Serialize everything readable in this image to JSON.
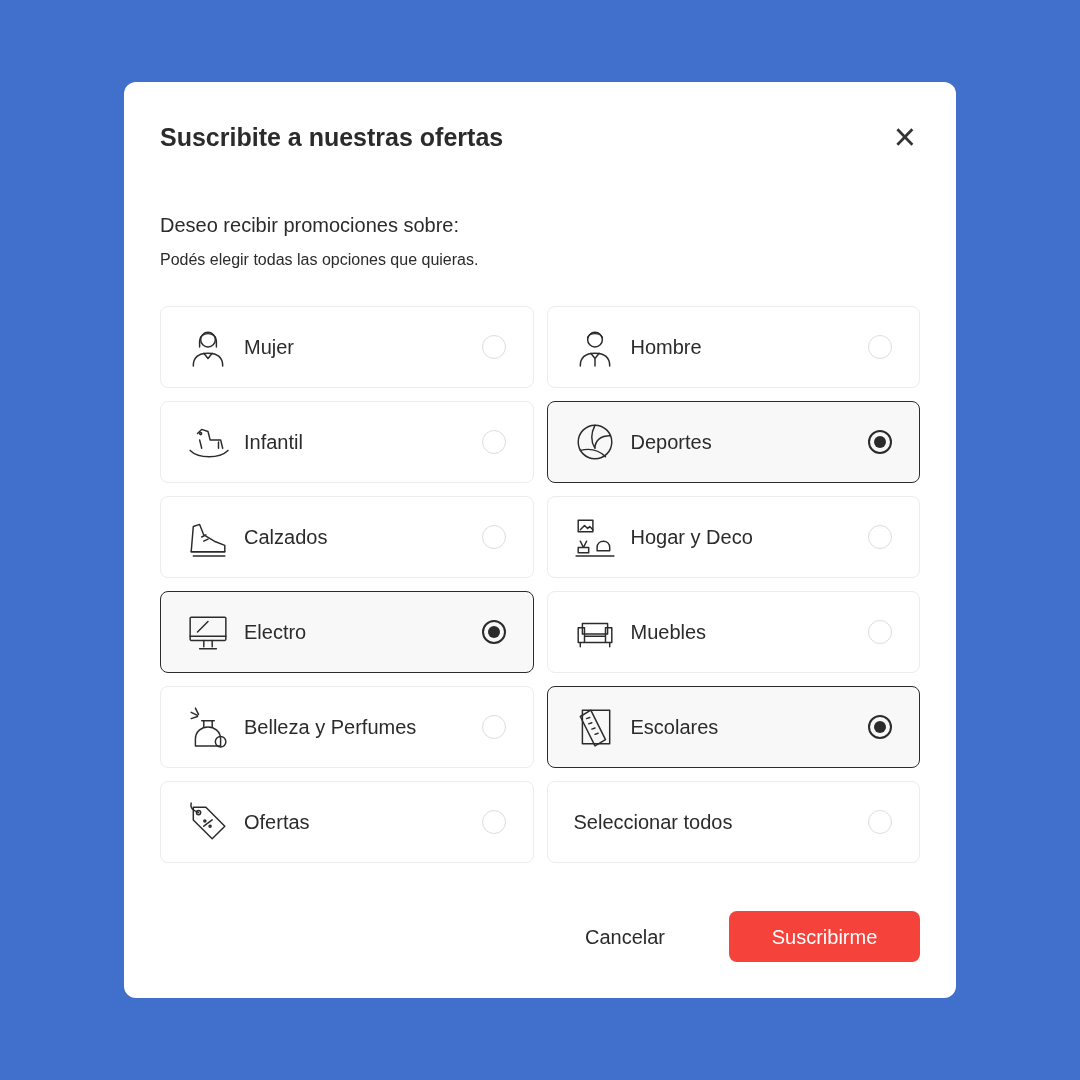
{
  "dialog": {
    "title": "Suscribite a nuestras ofertas",
    "close": "×"
  },
  "prompt": {
    "heading": "Deseo recibir promociones sobre:",
    "hint": "Podés elegir todas las opciones que quieras."
  },
  "options": [
    {
      "kind": "category",
      "label": "Mujer",
      "selected": false
    },
    {
      "kind": "category",
      "label": "Hombre",
      "selected": false
    },
    {
      "kind": "category",
      "label": "Infantil",
      "selected": false
    },
    {
      "kind": "category",
      "label": "Deportes",
      "selected": true
    },
    {
      "kind": "category",
      "label": "Calzados",
      "selected": false
    },
    {
      "kind": "category",
      "label": "Hogar y Deco",
      "selected": false
    },
    {
      "kind": "category",
      "label": "Electro",
      "selected": true
    },
    {
      "kind": "category",
      "label": "Muebles",
      "selected": false
    },
    {
      "kind": "category",
      "label": "Belleza y Perfumes",
      "selected": false
    },
    {
      "kind": "category",
      "label": "Escolares",
      "selected": true
    },
    {
      "kind": "category",
      "label": "Ofertas",
      "selected": false
    },
    {
      "kind": "select_all",
      "label": "Seleccionar todos",
      "selected": false
    }
  ],
  "buttons": {
    "cancel": "Cancelar",
    "submit": "Suscribirme"
  }
}
